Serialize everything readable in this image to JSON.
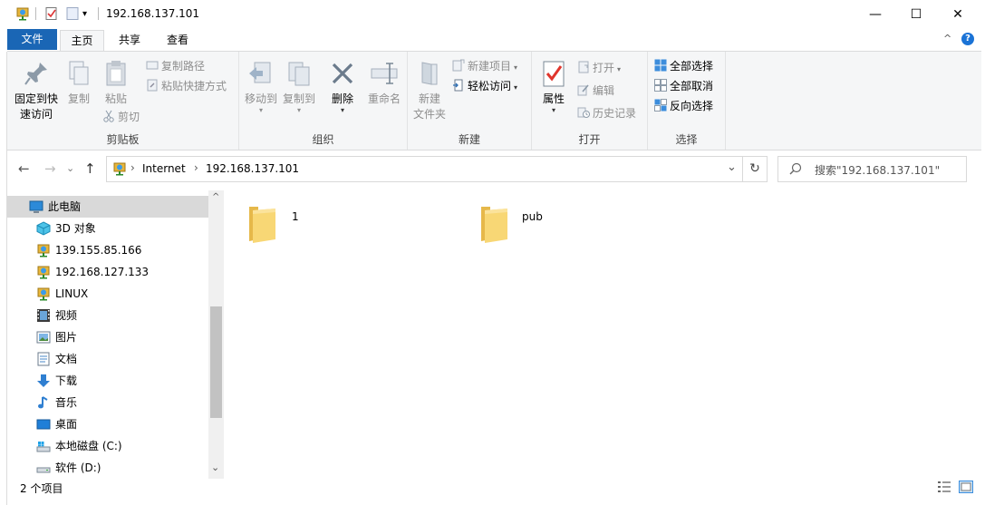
{
  "window": {
    "title": "192.168.137.101",
    "minimize_label": "—",
    "maximize_label": "☐",
    "close_label": "✕",
    "qa_dropdown": "▾"
  },
  "tabs": {
    "file": "文件",
    "home": "主页",
    "share": "共享",
    "view": "查看",
    "collapse": "^",
    "help": "?"
  },
  "ribbon": {
    "clipboard": {
      "label": "剪贴板",
      "pin": "固定到快\n速访问",
      "pin_l1": "固定到快",
      "pin_l2": "速访问",
      "copy": "复制",
      "paste": "粘贴",
      "copy_path": "复制路径",
      "paste_shortcut": "粘贴快捷方式",
      "cut": "剪切"
    },
    "organize": {
      "label": "组织",
      "move_to": "移动到",
      "copy_to": "复制到",
      "delete": "删除",
      "rename": "重命名"
    },
    "new": {
      "label": "新建",
      "new_folder_l1": "新建",
      "new_folder_l2": "文件夹",
      "new_item": "新建项目",
      "easy_access": "轻松访问"
    },
    "open": {
      "label": "打开",
      "properties": "属性",
      "open": "打开",
      "edit": "编辑",
      "history": "历史记录"
    },
    "select": {
      "label": "选择",
      "select_all": "全部选择",
      "select_none": "全部取消",
      "invert": "反向选择"
    }
  },
  "navigation": {
    "back": "←",
    "forward": "→",
    "recent": "⌄",
    "up": "↑",
    "breadcrumb": [
      "Internet",
      "192.168.137.101"
    ],
    "breadcrumb_sep": "›",
    "address_dropdown": "⌄",
    "refresh": "↻",
    "search_placeholder": "搜索\"192.168.137.101\""
  },
  "sidebar": {
    "items": [
      {
        "label": "此电脑",
        "icon": "pc-icon",
        "selected": true
      },
      {
        "label": "3D 对象",
        "icon": "3d-objects-icon"
      },
      {
        "label": "139.155.85.166",
        "icon": "network-location-icon"
      },
      {
        "label": "192.168.127.133",
        "icon": "network-location-icon"
      },
      {
        "label": "LINUX",
        "icon": "network-location-icon"
      },
      {
        "label": "视频",
        "icon": "video-icon"
      },
      {
        "label": "图片",
        "icon": "pictures-icon"
      },
      {
        "label": "文档",
        "icon": "documents-icon"
      },
      {
        "label": "下载",
        "icon": "download-icon"
      },
      {
        "label": "音乐",
        "icon": "music-icon"
      },
      {
        "label": "桌面",
        "icon": "desktop-icon"
      },
      {
        "label": "本地磁盘 (C:)",
        "icon": "local-disk-icon"
      },
      {
        "label": "软件 (D:)",
        "icon": "drive-icon"
      }
    ],
    "scroll_up": "^",
    "scroll_down": "⌄"
  },
  "files": [
    {
      "name": "1",
      "icon": "folder-icon"
    },
    {
      "name": "pub",
      "icon": "folder-icon"
    }
  ],
  "status": {
    "count": "2 个项目"
  },
  "colors": {
    "file_tab": "#1a66b5",
    "ribbon_bg": "#f5f6f7",
    "selected_nav": "#d9d9d9",
    "folder": "#f8d775"
  }
}
